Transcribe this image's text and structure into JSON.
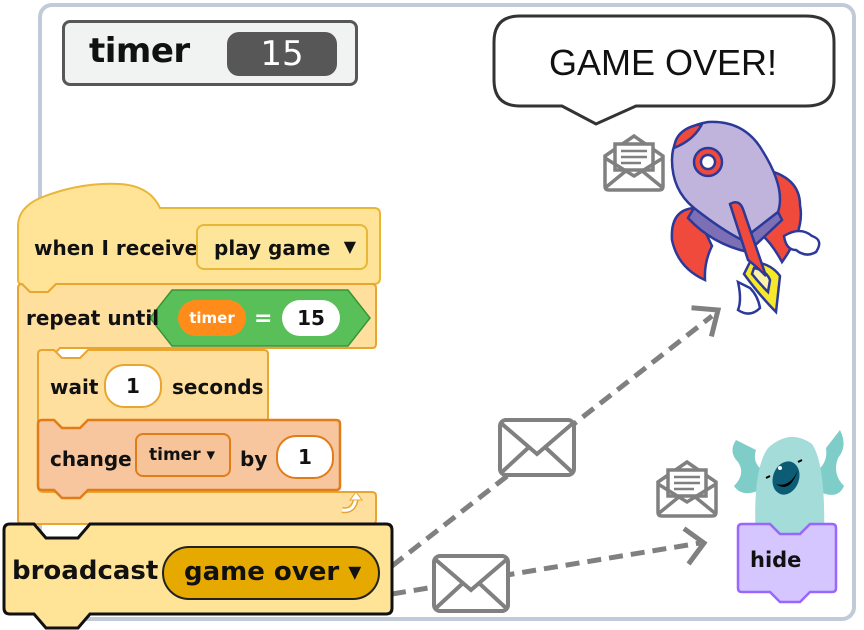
{
  "stage": {
    "border_color": "#c1cad8",
    "background": "#ffffff"
  },
  "monitor": {
    "label": "timer",
    "value": "15"
  },
  "speech_bubble": {
    "text": "GAME OVER!"
  },
  "script": {
    "hat_block": {
      "label": "when I receive",
      "message": "play game",
      "dropdown_icon": "caret-down-icon"
    },
    "repeat_block": {
      "label": "repeat until",
      "condition": {
        "variable": "timer",
        "operator": "=",
        "value": "15"
      },
      "loop_icon": "loop-arrow-icon"
    },
    "wait_block": {
      "label": "wait",
      "value": "1",
      "suffix": "seconds"
    },
    "change_block": {
      "label": "change",
      "variable": "timer ▾",
      "by_label": "by",
      "value": "1"
    },
    "broadcast_block": {
      "label": "broadcast",
      "message": "game over ▾"
    }
  },
  "receivers": {
    "rocket_sprite": {
      "name": "rocket",
      "icon": "open-envelope-icon"
    },
    "monster_sprite": {
      "name": "monster",
      "icon": "open-envelope-icon",
      "block_label": "hide"
    }
  },
  "messages": {
    "envelope_icon": "envelope-icon"
  },
  "colors": {
    "events": "#ffd966",
    "control": "#ffab19",
    "variables": "#ff8c1a",
    "operators": "#59c059",
    "looks": "#cfb9ff",
    "arrow": "#808080"
  }
}
